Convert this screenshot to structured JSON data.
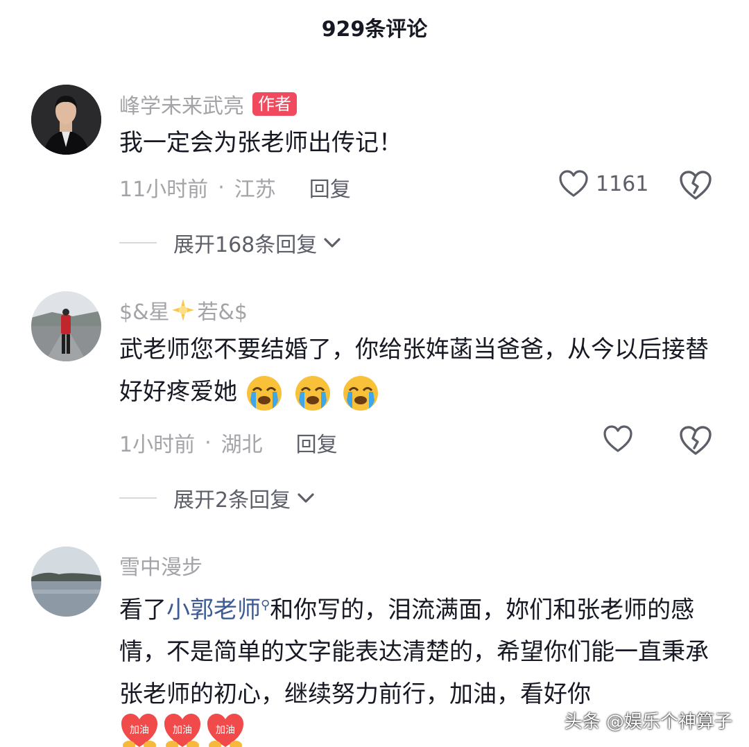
{
  "header": {
    "title": "929条评论"
  },
  "comments": [
    {
      "name": "峰学未来武亮",
      "tag": "作者",
      "text": "我一定会为张老师出传记！",
      "time": "11小时前",
      "location": "江苏",
      "reply": "回复",
      "likes": "1161",
      "expand": "展开168条回复"
    },
    {
      "name_before": "$&星",
      "name_after": "若&$",
      "text": "武老师您不要结婚了，你给张姩菡当爸爸，从今以后接替好好疼爱她",
      "time": "1小时前",
      "location": "湖北",
      "reply": "回复",
      "expand": "展开2条回复"
    },
    {
      "name": "雪中漫步",
      "text_before": "看了",
      "mention": "小郭老师",
      "text_after": "和你写的，泪流满面，妳们和张老师的感情，不是简单的文字能表达清楚的，希望你们能一直秉承张老师的初心，继续努力前行，加油，看好你",
      "sticker_label": "加油"
    }
  ],
  "separator": "·",
  "watermark": "头条 @娱乐个神算子",
  "colors": {
    "author_tag": "#f14a5e",
    "mention": "#3c5a94",
    "muted": "#a3a3a8"
  }
}
